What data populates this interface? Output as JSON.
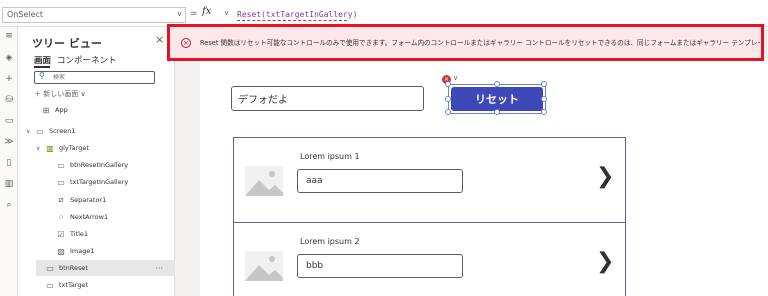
{
  "formula_bar": {
    "property": "OnSelect",
    "equals": "=",
    "fx": "fx",
    "formula": "Reset(txtTargetInGallery)"
  },
  "rail": {
    "icons": [
      "hamburger-icon",
      "layers-icon",
      "plus-icon",
      "database-icon",
      "media-icon",
      "flow-icon",
      "variables-icon",
      "search-icon"
    ]
  },
  "tree": {
    "title": "ツリー ビュー",
    "tabs": [
      "画面",
      "コンポーネント"
    ],
    "search_placeholder": "検索",
    "new_screen": "＋ 新しい画面 ∨",
    "nodes": [
      {
        "label": "App",
        "icon": "app-icon"
      },
      {
        "label": "Screen1",
        "icon": "screen-icon"
      },
      {
        "label": "glyTarget",
        "icon": "gallery-icon"
      },
      {
        "label": "btnResetInGallery",
        "icon": "button-icon"
      },
      {
        "label": "txtTargetInGallery",
        "icon": "textinput-icon"
      },
      {
        "label": "Separator1",
        "icon": "separator-icon"
      },
      {
        "label": "NextArrow1",
        "icon": "arrow-icon"
      },
      {
        "label": "Title1",
        "icon": "label-icon"
      },
      {
        "label": "Image1",
        "icon": "image-icon"
      },
      {
        "label": "btnReset",
        "icon": "button-icon",
        "more": "···"
      },
      {
        "label": "txtTarget",
        "icon": "textinput-icon"
      }
    ]
  },
  "canvas": {
    "default_input_value": "デフォだよ",
    "reset_button_label": "リセット",
    "gallery_items": [
      {
        "title": "Lorem ipsum 1",
        "value": "aaa"
      },
      {
        "title": "Lorem ipsum 2",
        "value": "bbb"
      }
    ]
  },
  "error": {
    "message": "Reset 関数はリセット可能なコントロールのみで使用できます。フォーム内のコントロールまたはギャラリー コントロールをリセットできるのは、同じフォームまたはギャラリー テンプレート内からのみです。"
  },
  "colors": {
    "accent": "#3e48b8",
    "error_border": "#e81123",
    "error_bg": "#fde7e9",
    "gallery_border": "#6b5b95"
  }
}
